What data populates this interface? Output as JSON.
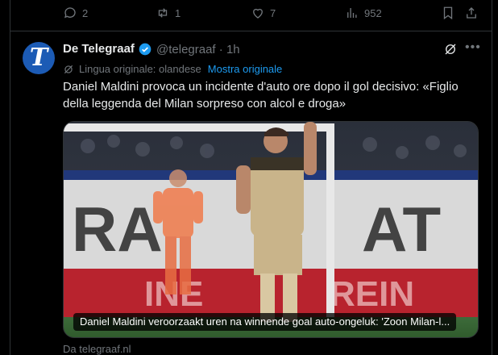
{
  "actions": {
    "reply_count": "2",
    "repost_count": "1",
    "like_count": "7",
    "view_count": "952"
  },
  "post": {
    "author_name": "De Telegraaf",
    "handle": "@telegraaf",
    "separator": "·",
    "time": "1h",
    "avatar_letter": "T",
    "original_language_label": "Lingua originale: olandese",
    "show_original_label": "Mostra originale",
    "text_line1": "Daniel Maldini provoca un incidente d'auto ore dopo il gol decisivo: «Figlio",
    "text_line2": "della leggenda del Milan sorpreso con alcol e droga»",
    "media_caption": "Daniel Maldini veroorzaakt uren na winnende goal auto-ongeluk: 'Zoon Milan-l...",
    "source": "Da telegraaf.nl"
  },
  "colors": {
    "background": "#000000",
    "text": "#e7e9ea",
    "muted": "#71767b",
    "accent": "#1d9bf0",
    "avatar": "#1c5bb5"
  },
  "icons": [
    "reply-icon",
    "repost-icon",
    "like-icon",
    "views-icon",
    "bookmark-icon",
    "share-icon",
    "verified-icon",
    "grok-icon",
    "more-icon",
    "translate-icon"
  ]
}
